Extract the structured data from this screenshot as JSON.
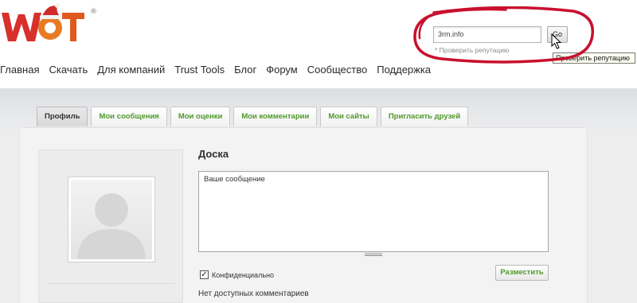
{
  "brand": {
    "logo_text": "WOT",
    "registered": "®"
  },
  "search": {
    "value": "3rm.info",
    "go_label": "Go",
    "hint": "* Проверить репутацию",
    "tooltip": "Проверить репутацию"
  },
  "nav": {
    "items": [
      "Главная",
      "Скачать",
      "Для компаний",
      "Trust Tools",
      "Блог",
      "Форум",
      "Сообщество",
      "Поддержка"
    ]
  },
  "tabs": {
    "items": [
      {
        "label": "Профиль",
        "active": true
      },
      {
        "label": "Мои сообщения",
        "active": false
      },
      {
        "label": "Мои оценки",
        "active": false
      },
      {
        "label": "Мои комментарии",
        "active": false
      },
      {
        "label": "Мои сайты",
        "active": false
      },
      {
        "label": "Пригласить друзей",
        "active": false
      }
    ]
  },
  "board": {
    "title": "Доска",
    "message_value": "Ваше сообщение",
    "private_checked": true,
    "private_label": "Конфиденциально",
    "post_label": "Разместить",
    "empty_text": "Нет доступных комментариев"
  },
  "colors": {
    "accent_green": "#4f9a2c",
    "logo_red": "#d8302b",
    "highlight_ring": "#c8102e"
  }
}
